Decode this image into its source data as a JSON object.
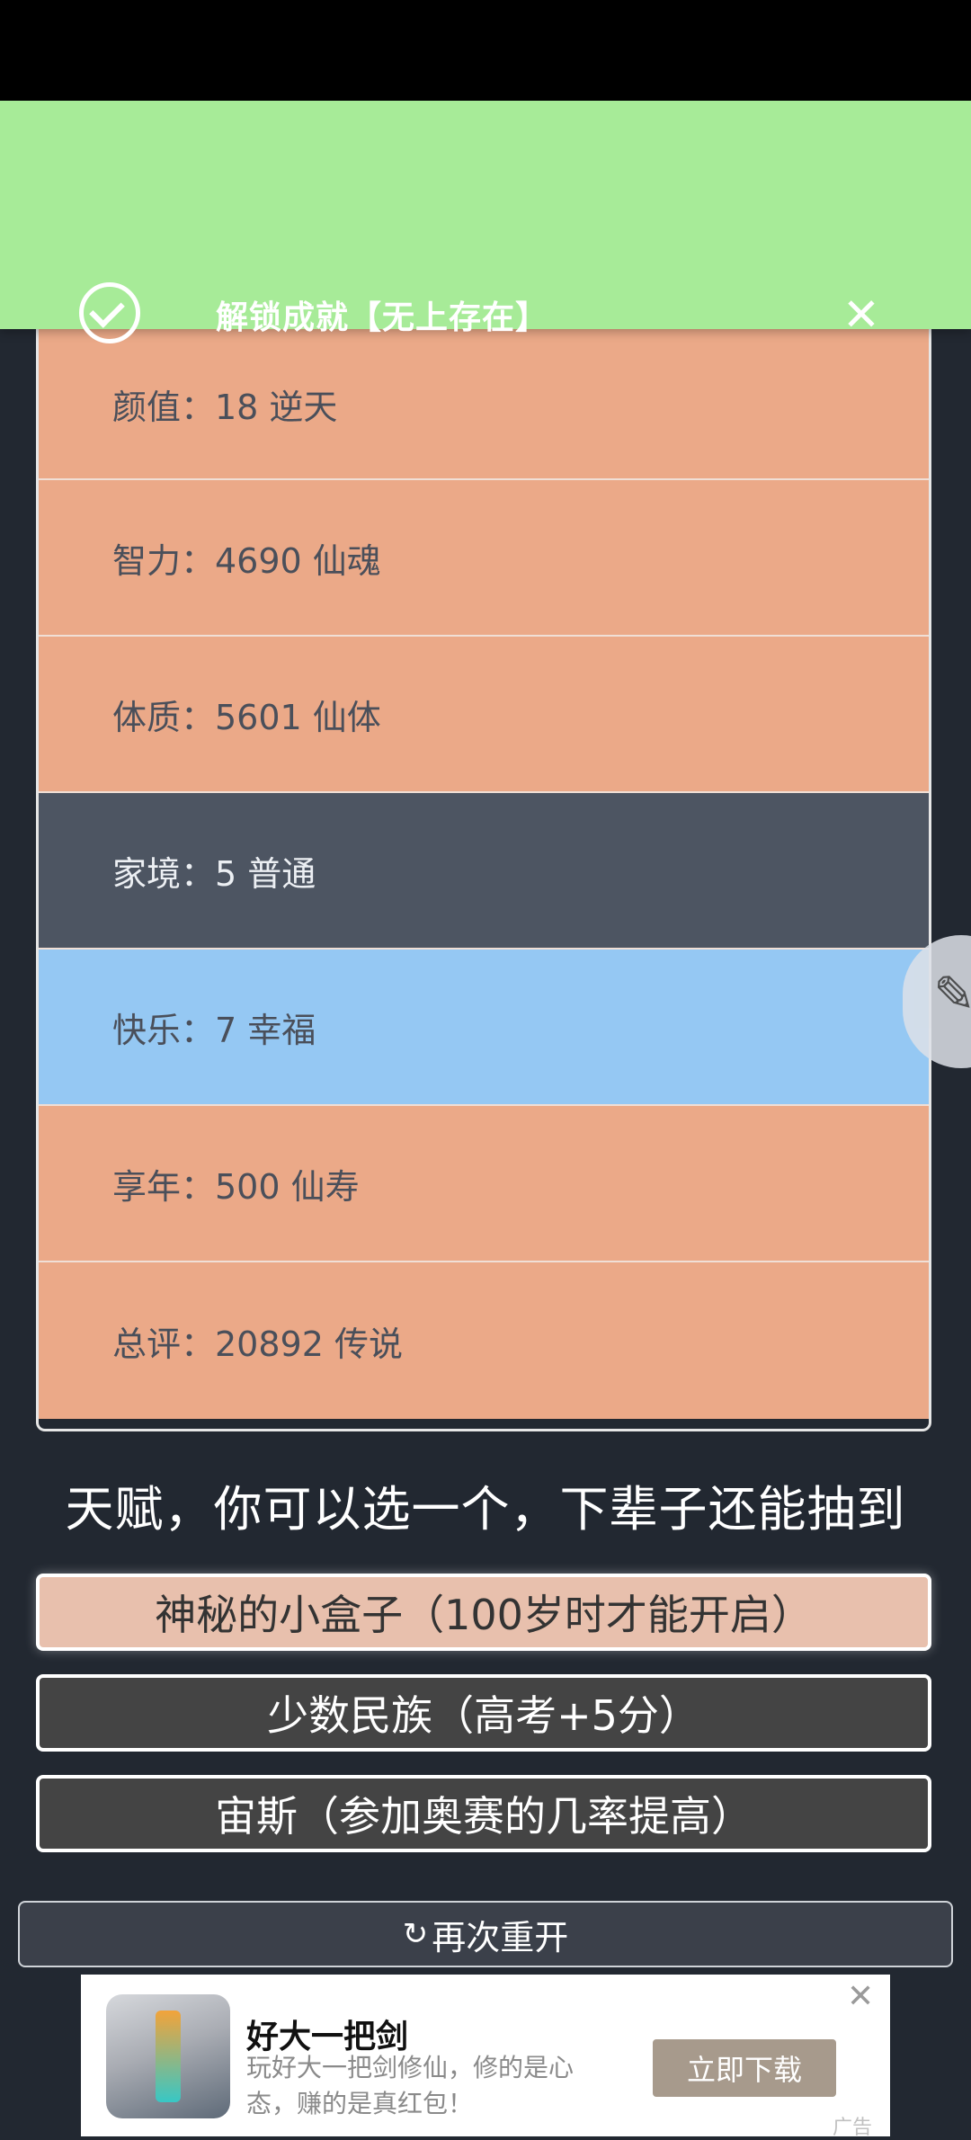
{
  "toast": {
    "icon": "check-circle-icon",
    "message": "解锁成就【无上存在】",
    "close_symbol": "✕"
  },
  "stats": [
    {
      "label": "颜值：18 逆天",
      "color": "#eba988"
    },
    {
      "label": "智力：4690 仙魂",
      "color": "#eba988"
    },
    {
      "label": "体质：5601 仙体",
      "color": "#eba988"
    },
    {
      "label": "家境：5 普通",
      "color": "#4d5562"
    },
    {
      "label": "快乐：7 幸福",
      "color": "#95c8f3"
    },
    {
      "label": "享年：500 仙寿",
      "color": "#eba988"
    },
    {
      "label": "总评：20892 传说",
      "color": "#eba988"
    }
  ],
  "prompt": "天赋，你可以选一个，下辈子还能抽到",
  "choices": [
    {
      "label": "神秘的小盒子（100岁时才能开启）",
      "selected": true
    },
    {
      "label": "少数民族（高考+5分）",
      "selected": false
    },
    {
      "label": "宙斯（参加奥赛的几率提高）",
      "selected": false
    }
  ],
  "restart": {
    "icon": "refresh-icon",
    "symbol": "↻",
    "label": "再次重开"
  },
  "ad": {
    "title": "好大一把剑",
    "description": "玩好大一把剑修仙，修的是心态，赚的是真红包！",
    "button": "立即下载",
    "close_symbol": "✕",
    "tag": "广告"
  }
}
